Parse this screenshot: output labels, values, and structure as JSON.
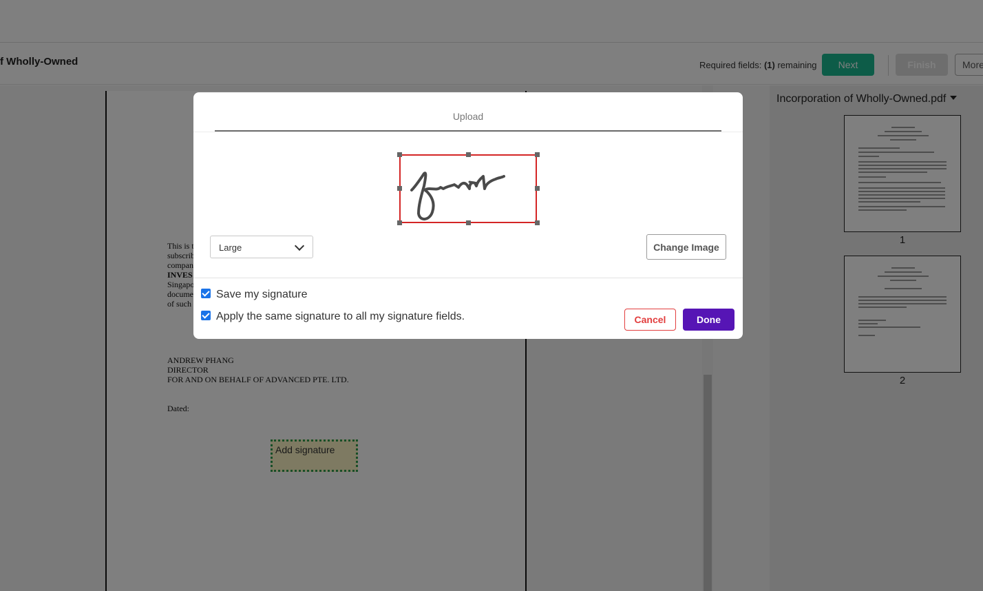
{
  "header": {
    "doc_title": "f Wholly-Owned",
    "required_prefix": "Required fields: ",
    "required_count": "(1)",
    "required_suffix": " remaining",
    "next_label": "Next",
    "finish_label": "Finish",
    "more_label": "More"
  },
  "document": {
    "paragraph_lines": [
      "This is t",
      "subscrib",
      "compan",
      "INVES",
      "Singapo",
      "docume",
      "of such"
    ],
    "signatory_name": "ANDREW PHANG",
    "signatory_title": "DIRECTOR",
    "signatory_company": "FOR AND ON BEHALF OF ADVANCED PTE. LTD.",
    "dated_label": "Dated:",
    "signature_field_label": "Add signature"
  },
  "thumbnails": {
    "file_name": "Incorporation of Wholly-Owned.pdf",
    "pages": [
      {
        "number": "1"
      },
      {
        "number": "2"
      }
    ]
  },
  "modal": {
    "tab_label": "Upload",
    "size_value": "Large",
    "change_image_label": "Change Image",
    "save_signature_label": "Save my signature",
    "save_signature_checked": true,
    "apply_all_label": "Apply the same signature to all my signature fields.",
    "apply_all_checked": true,
    "cancel_label": "Cancel",
    "done_label": "Done"
  },
  "colors": {
    "next_button": "#1ab990",
    "done_button": "#5615b5",
    "cancel_border": "#e23d3d",
    "selection_border": "#d42525",
    "signature_field_fill": "#fcf5c4",
    "signature_field_border": "#2e9c4e",
    "checkbox": "#1a73e8"
  }
}
